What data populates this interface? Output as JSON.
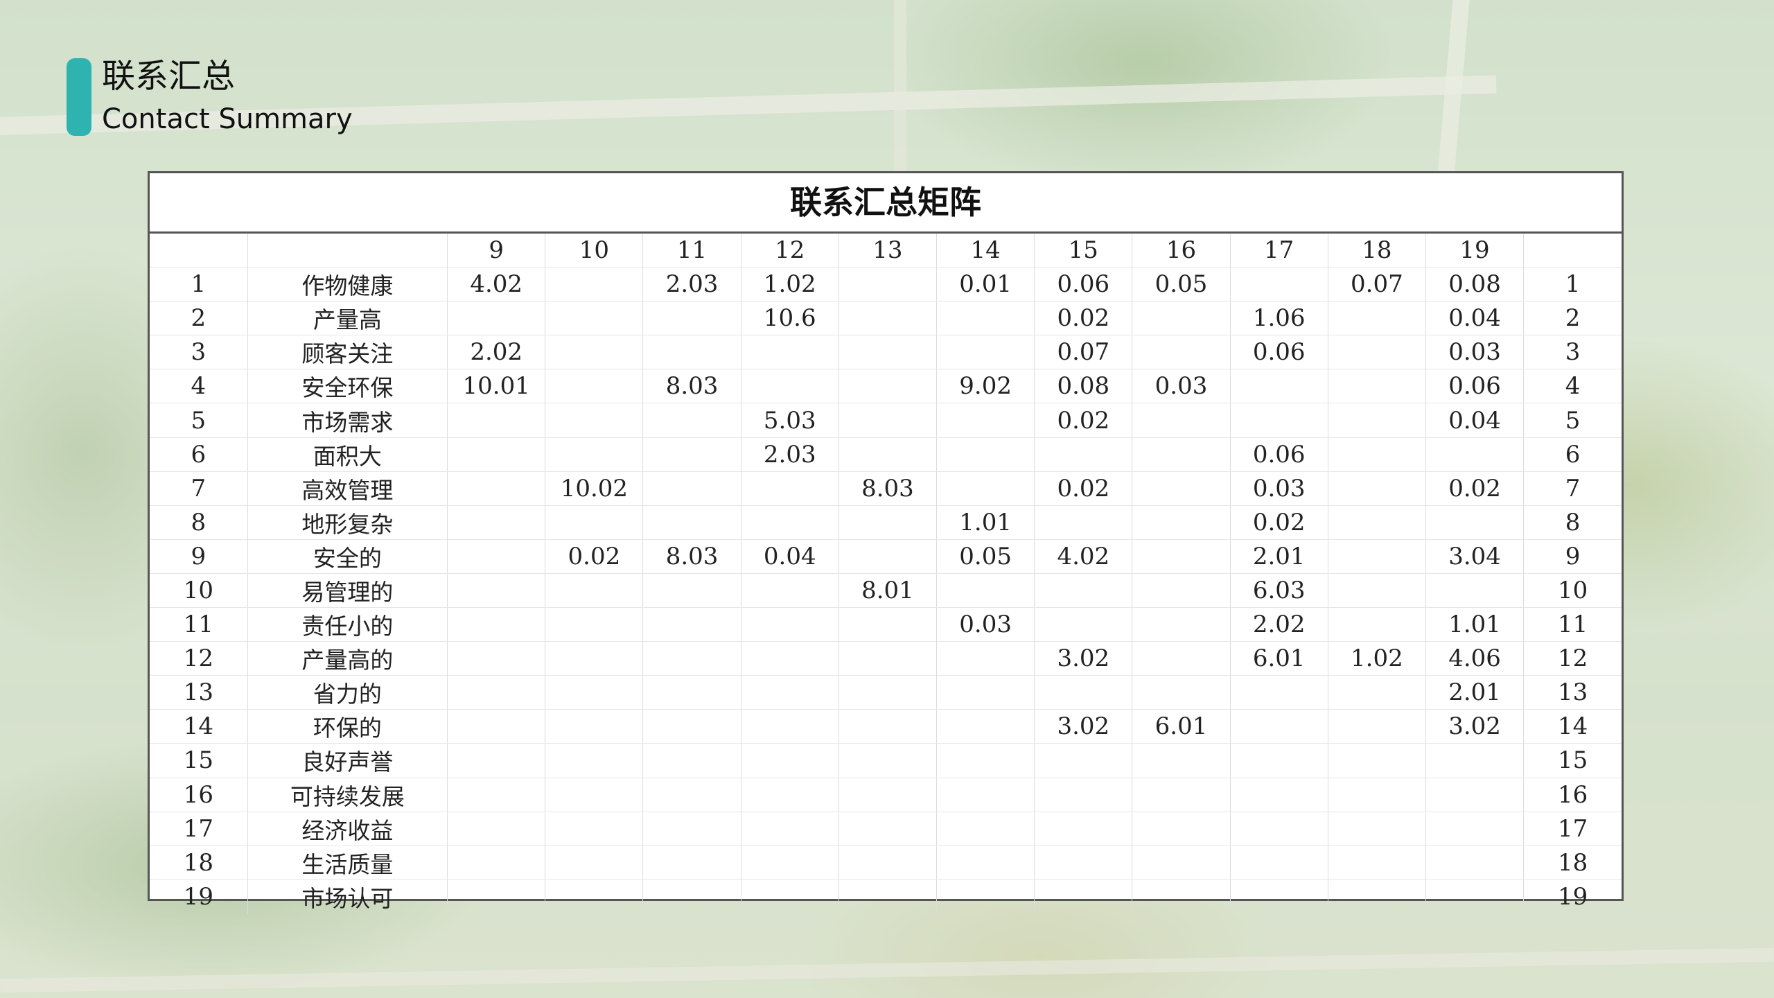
{
  "header": {
    "title_cn": "联系汇总",
    "title_en": "Contact Summary",
    "accent_color": "#2fb3b1"
  },
  "matrix": {
    "title": "联系汇总矩阵",
    "columns": [
      "9",
      "10",
      "11",
      "12",
      "13",
      "14",
      "15",
      "16",
      "17",
      "18",
      "19"
    ],
    "rows": [
      {
        "id": "1",
        "label": "作物健康",
        "cells": [
          "4.02",
          "",
          "2.03",
          "1.02",
          "",
          "0.01",
          "0.06",
          "0.05",
          "",
          "0.07",
          "0.08"
        ],
        "end": "1"
      },
      {
        "id": "2",
        "label": "产量高",
        "cells": [
          "",
          "",
          "",
          "10.6",
          "",
          "",
          "0.02",
          "",
          "1.06",
          "",
          "0.04"
        ],
        "end": "2"
      },
      {
        "id": "3",
        "label": "顾客关注",
        "cells": [
          "2.02",
          "",
          "",
          "",
          "",
          "",
          "0.07",
          "",
          "0.06",
          "",
          "0.03"
        ],
        "end": "3"
      },
      {
        "id": "4",
        "label": "安全环保",
        "cells": [
          "10.01",
          "",
          "8.03",
          "",
          "",
          "9.02",
          "0.08",
          "0.03",
          "",
          "",
          "0.06"
        ],
        "end": "4"
      },
      {
        "id": "5",
        "label": "市场需求",
        "cells": [
          "",
          "",
          "",
          "5.03",
          "",
          "",
          "0.02",
          "",
          "",
          "",
          "0.04"
        ],
        "end": "5"
      },
      {
        "id": "6",
        "label": "面积大",
        "cells": [
          "",
          "",
          "",
          "2.03",
          "",
          "",
          "",
          "",
          "0.06",
          "",
          ""
        ],
        "end": "6"
      },
      {
        "id": "7",
        "label": "高效管理",
        "cells": [
          "",
          "10.02",
          "",
          "",
          "8.03",
          "",
          "0.02",
          "",
          "0.03",
          "",
          "0.02"
        ],
        "end": "7"
      },
      {
        "id": "8",
        "label": "地形复杂",
        "cells": [
          "",
          "",
          "",
          "",
          "",
          "1.01",
          "",
          "",
          "0.02",
          "",
          ""
        ],
        "end": "8"
      },
      {
        "id": "9",
        "label": "安全的",
        "cells": [
          "",
          "0.02",
          "8.03",
          "0.04",
          "",
          "0.05",
          "4.02",
          "",
          "2.01",
          "",
          "3.04"
        ],
        "end": "9"
      },
      {
        "id": "10",
        "label": "易管理的",
        "cells": [
          "",
          "",
          "",
          "",
          "8.01",
          "",
          "",
          "",
          "6.03",
          "",
          ""
        ],
        "end": "10"
      },
      {
        "id": "11",
        "label": "责任小的",
        "cells": [
          "",
          "",
          "",
          "",
          "",
          "0.03",
          "",
          "",
          "2.02",
          "",
          "1.01"
        ],
        "end": "11"
      },
      {
        "id": "12",
        "label": "产量高的",
        "cells": [
          "",
          "",
          "",
          "",
          "",
          "",
          "3.02",
          "",
          "6.01",
          "1.02",
          "4.06"
        ],
        "end": "12"
      },
      {
        "id": "13",
        "label": "省力的",
        "cells": [
          "",
          "",
          "",
          "",
          "",
          "",
          "",
          "",
          "",
          "",
          "2.01"
        ],
        "end": "13"
      },
      {
        "id": "14",
        "label": "环保的",
        "cells": [
          "",
          "",
          "",
          "",
          "",
          "",
          "3.02",
          "6.01",
          "",
          "",
          "3.02"
        ],
        "end": "14"
      },
      {
        "id": "15",
        "label": "良好声誉",
        "cells": [
          "",
          "",
          "",
          "",
          "",
          "",
          "",
          "",
          "",
          "",
          ""
        ],
        "end": "15"
      },
      {
        "id": "16",
        "label": "可持续发展",
        "cells": [
          "",
          "",
          "",
          "",
          "",
          "",
          "",
          "",
          "",
          "",
          ""
        ],
        "end": "16"
      },
      {
        "id": "17",
        "label": "经济收益",
        "cells": [
          "",
          "",
          "",
          "",
          "",
          "",
          "",
          "",
          "",
          "",
          ""
        ],
        "end": "17"
      },
      {
        "id": "18",
        "label": "生活质量",
        "cells": [
          "",
          "",
          "",
          "",
          "",
          "",
          "",
          "",
          "",
          "",
          ""
        ],
        "end": "18"
      },
      {
        "id": "19",
        "label": "市场认可",
        "cells": [
          "",
          "",
          "",
          "",
          "",
          "",
          "",
          "",
          "",
          "",
          ""
        ],
        "end": "19"
      }
    ]
  }
}
